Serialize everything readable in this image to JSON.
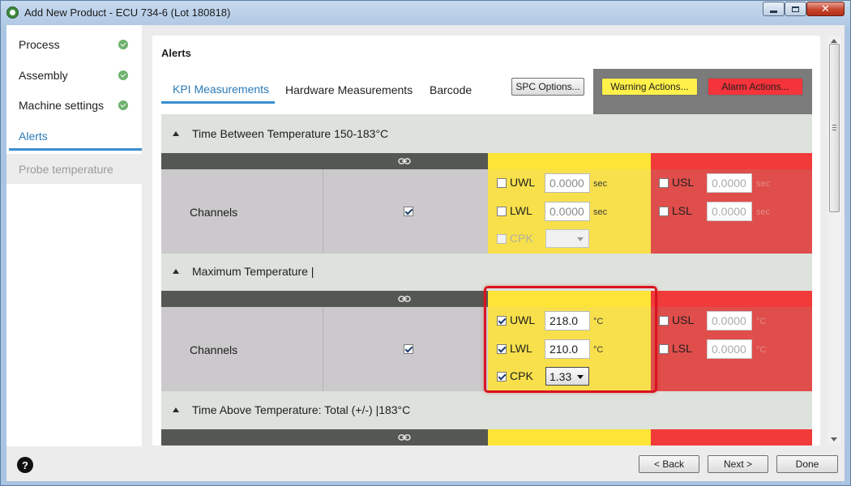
{
  "window": {
    "title": "Add New Product - ECU 734-6 (Lot 180818)"
  },
  "sidebar": {
    "items": [
      {
        "label": "Process",
        "state": "done"
      },
      {
        "label": "Assembly",
        "state": "done"
      },
      {
        "label": "Machine settings",
        "state": "done"
      },
      {
        "label": "Alerts",
        "state": "active"
      },
      {
        "label": "Probe temperature",
        "state": "disabled"
      }
    ]
  },
  "main": {
    "title": "Alerts",
    "tabs": [
      {
        "label": "KPI Measurements",
        "active": true
      },
      {
        "label": "Hardware Measurements",
        "active": false
      },
      {
        "label": "Barcode",
        "active": false
      }
    ],
    "buttons": {
      "spc": "SPC Options...",
      "warning": "Warning Actions...",
      "alarm": "Alarm Actions..."
    },
    "groups": [
      {
        "title": "Time Between Temperature 150-183°C",
        "channel_label": "Channels",
        "channel_checked": true,
        "warning": {
          "uwl": {
            "label": "UWL",
            "checked": false,
            "value": "0.0000",
            "unit": "sec"
          },
          "lwl": {
            "label": "LWL",
            "checked": false,
            "value": "0.0000",
            "unit": "sec"
          },
          "cpk": {
            "label": "CPK",
            "checked": false,
            "value": ""
          }
        },
        "alarm": {
          "usl": {
            "label": "USL",
            "checked": false,
            "value": "0.0000",
            "unit": "sec"
          },
          "lsl": {
            "label": "LSL",
            "checked": false,
            "value": "0.0000",
            "unit": "sec"
          }
        }
      },
      {
        "title": "Maximum Temperature |",
        "channel_label": "Channels",
        "channel_checked": true,
        "warning": {
          "uwl": {
            "label": "UWL",
            "checked": true,
            "value": "218.0",
            "unit": "°C"
          },
          "lwl": {
            "label": "LWL",
            "checked": true,
            "value": "210.0",
            "unit": "°C"
          },
          "cpk": {
            "label": "CPK",
            "checked": true,
            "value": "1.33"
          }
        },
        "alarm": {
          "usl": {
            "label": "USL",
            "checked": false,
            "value": "0.0000",
            "unit": "°C"
          },
          "lsl": {
            "label": "LSL",
            "checked": false,
            "value": "0.0000",
            "unit": "°C"
          }
        }
      },
      {
        "title": "Time Above Temperature: Total (+/-) |183°C"
      }
    ]
  },
  "footer": {
    "help": "?",
    "back": "< Back",
    "next": "Next >",
    "done": "Done"
  },
  "colors": {
    "accent": "#3a8fd0",
    "warning": "#fde436",
    "alarm": "#f13b3b",
    "highlight": "#d8141f"
  }
}
